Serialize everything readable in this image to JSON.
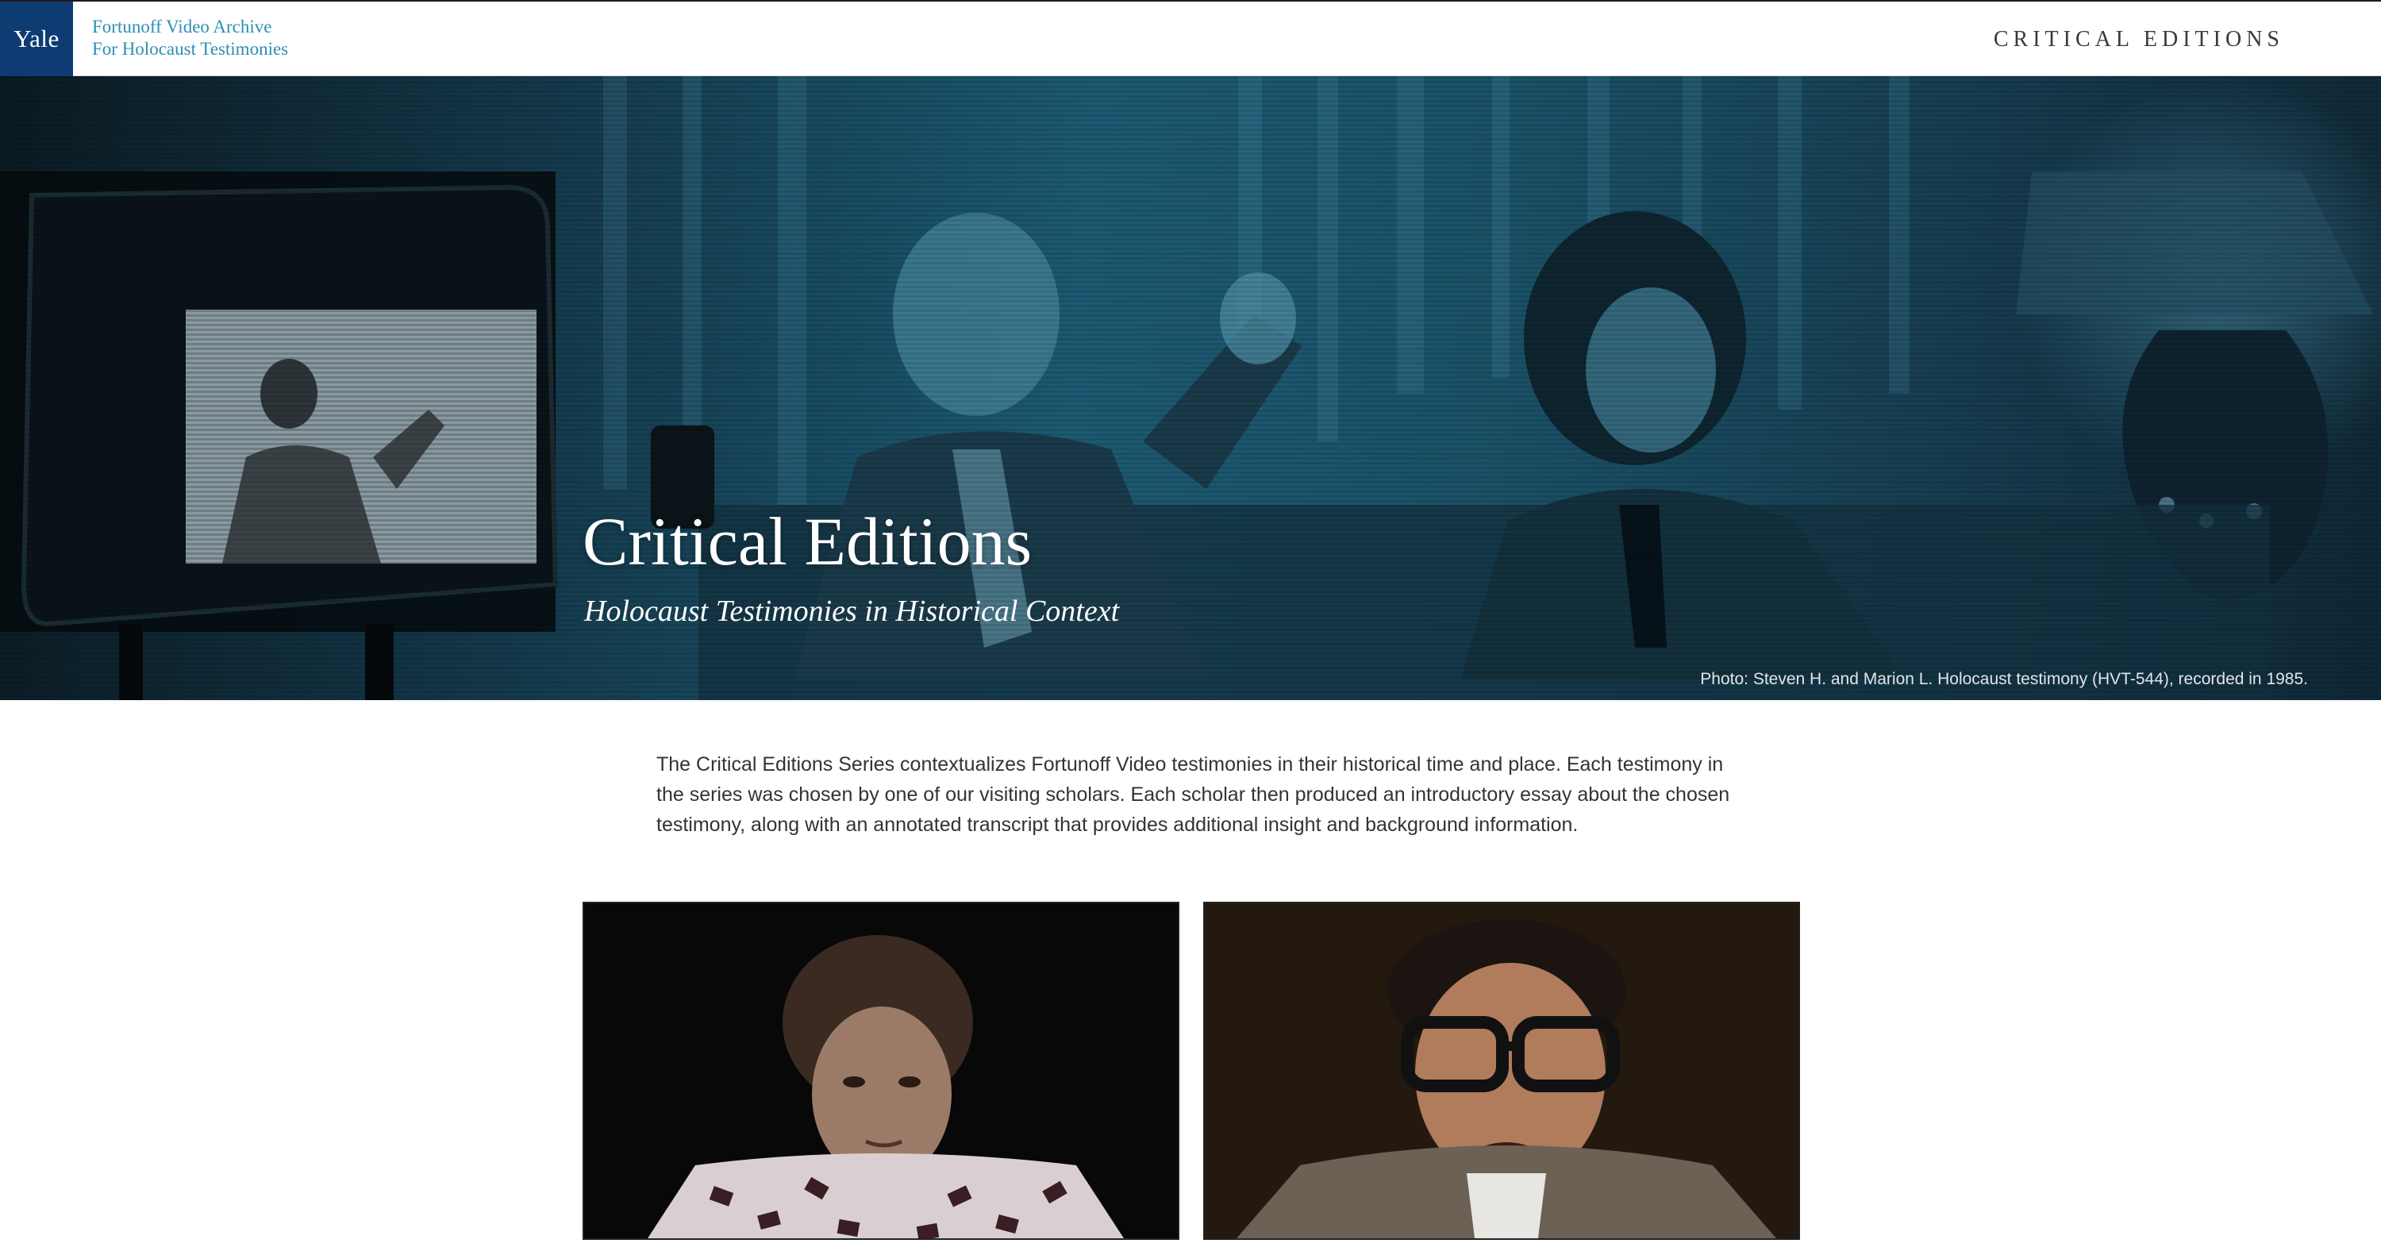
{
  "header": {
    "logo": "Yale",
    "archive_line1": "Fortunoff Video Archive",
    "archive_line2": "For Holocaust Testimonies",
    "nav_link": "CRITICAL EDITIONS"
  },
  "hero": {
    "title": "Critical Editions",
    "subtitle": "Holocaust Testimonies in Historical Context",
    "photo_credit": "Photo: Steven H. and Marion L. Holocaust testimony (HVT-544), recorded in 1985."
  },
  "intro": {
    "text": "The Critical Editions Series contextualizes Fortunoff Video testimonies in their historical time and place. Each testimony in the series was chosen by one of our visiting scholars. Each scholar then produced an introductory essay about the chosen testimony, along with an annotated transcript that provides additional insight and background information."
  },
  "colors": {
    "yale_blue": "#0f3b73",
    "link_teal": "#2b8fb5",
    "hero_tint": "#1c5a72"
  }
}
